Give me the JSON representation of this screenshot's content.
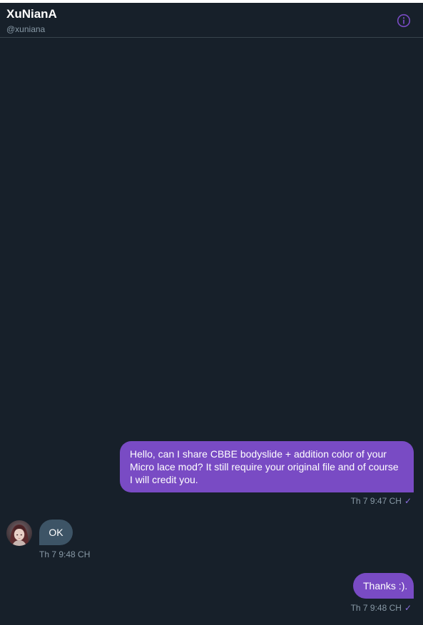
{
  "header": {
    "title": "XuNianA",
    "handle": "@xuniana",
    "info_icon": "info-circle-icon"
  },
  "messages": [
    {
      "direction": "outgoing",
      "text": "Hello, can I share CBBE bodyslide + addition color of your Micro lace mod? It still require your original file and of course I will credit you.",
      "time": "Th 7 9:47 CH",
      "status_icon": "check-icon"
    },
    {
      "direction": "incoming",
      "text": "OK",
      "time": "Th 7 9:48 CH",
      "avatar_icon": "avatar"
    },
    {
      "direction": "outgoing",
      "text": "Thanks :).",
      "time": "Th 7 9:48 CH",
      "status_icon": "check-icon"
    }
  ],
  "colors": {
    "background": "#17202a",
    "accent": "#794bc4",
    "incoming_bubble": "#3d5466",
    "muted_text": "#8899a6"
  }
}
